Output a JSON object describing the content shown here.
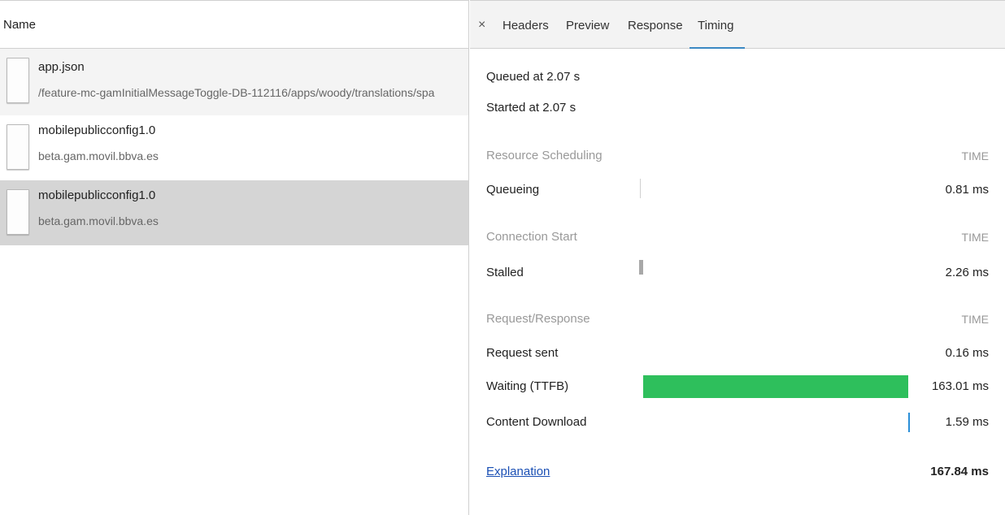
{
  "requests": {
    "header": "Name",
    "items": [
      {
        "name": "app.json",
        "domain": "/feature-mc-gamInitialMessageToggle-DB-112116/apps/woody/translations/spa"
      },
      {
        "name": "mobilepublicconfig1.0",
        "domain": "beta.gam.movil.bbva.es"
      },
      {
        "name": "mobilepublicconfig1.0",
        "domain": "beta.gam.movil.bbva.es"
      }
    ]
  },
  "tabs": {
    "close_glyph": "×",
    "headers": "Headers",
    "preview": "Preview",
    "response": "Response",
    "timing": "Timing",
    "active": "Timing"
  },
  "timing": {
    "queued": "Queued at 2.07 s",
    "started": "Started at 2.07 s",
    "sections": [
      {
        "title": "Resource Scheduling",
        "time_label": "TIME",
        "rows": [
          {
            "label": "Queueing",
            "value": "0.81 ms",
            "color": "#d0d0d0"
          }
        ]
      },
      {
        "title": "Connection Start",
        "time_label": "TIME",
        "rows": [
          {
            "label": "Stalled",
            "value": "2.26 ms",
            "color": "#a8a8a8"
          }
        ]
      },
      {
        "title": "Request/Response",
        "time_label": "TIME",
        "rows": [
          {
            "label": "Request sent",
            "value": "0.16 ms",
            "color": "#ffffff"
          },
          {
            "label": "Waiting (TTFB)",
            "value": "163.01 ms",
            "color": "#2ebf5c"
          },
          {
            "label": "Content Download",
            "value": "1.59 ms",
            "color": "#2b8fd8"
          }
        ]
      }
    ],
    "explanation_link": "Explanation",
    "total": "167.84 ms"
  }
}
